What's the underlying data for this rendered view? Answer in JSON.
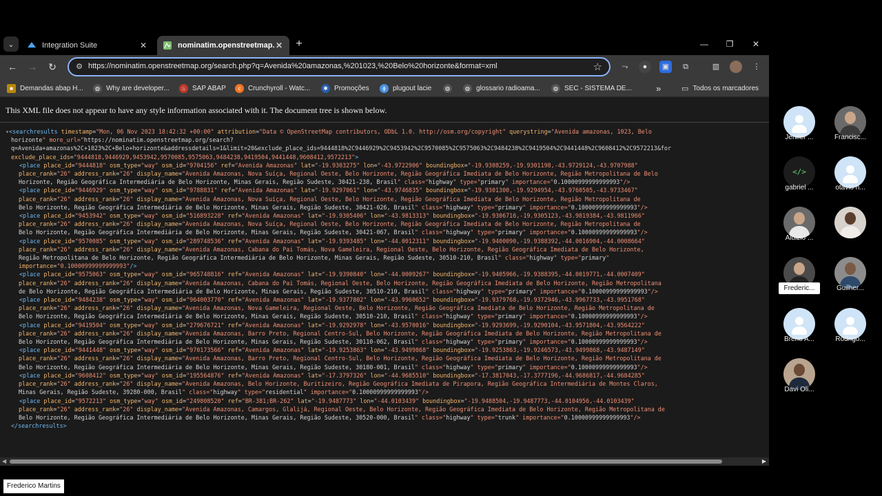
{
  "tabs": [
    {
      "label": "Integration Suite",
      "icon": "sap-icon",
      "close": "✕"
    },
    {
      "label": "nominatim.openstreetmap.org",
      "icon": "osm-icon",
      "close": "✕"
    }
  ],
  "window_controls": {
    "minimize": "—",
    "maximize": "❐",
    "close": "✕"
  },
  "omnibox": {
    "url": "https://nominatim.openstreetmap.org/search.php?q=Avenida%20amazonas,%201023,%20Belo%20horizonte&format=xml"
  },
  "bookmarks": [
    {
      "label": "Demandas abap H...",
      "icon": "bookmark-icon"
    },
    {
      "label": "Why are developer...",
      "icon": "globe-icon"
    },
    {
      "label": "SAP ABAP",
      "icon": "flame-icon"
    },
    {
      "label": "Crunchyroll - Watc...",
      "icon": "crunchyroll-icon"
    },
    {
      "label": "Promoções",
      "icon": "promo-icon"
    },
    {
      "label": "plugout lacie",
      "icon": "plug-icon"
    },
    {
      "label": "",
      "icon": "globe-icon"
    },
    {
      "label": "glossario radioama...",
      "icon": "globe-icon"
    },
    {
      "label": "SEC - SISTEMA DE...",
      "icon": "globe-icon"
    }
  ],
  "bookmarks_overflow": "»",
  "all_bookmarks": "Todos os marcadores",
  "xml_notice": "This XML file does not appear to have any style information associated with it. The document tree is shown below.",
  "xml": {
    "root_open": "<searchresults timestamp=\"Mon, 06 Nov 2023 18:42:32 +00:00\" attribution=\"Data © OpenStreetMap contributors, ODbL 1.0. http://osm.org/copyright\" querystring=\"Avenida amazonas, 1023, Belo",
    "root_lines": [
      "horizonte\" more_url=\"https://nominatim.openstreetmap.org/search?",
      "q=Avenida+amazonas%2C+1023%2C+Belo+horizonte&addressdetails=1&limit=20&exclude_place_ids=9444818%2C9446929%2C9453942%2C9570085%2C9575063%2C9484238%2C9419504%2C9441448%2C9608412%2C9572213&for",
      "exclude_place_ids=\"9444818,9446929,9453942,9570085,9575063,9484238,9419504,9441448,9608412,9572213\">"
    ],
    "places": [
      [
        "<place place_id=\"9444818\" osm_type=\"way\" osm_id=\"9704156\" ref=\"Avenida Amazonas\" lat=\"-19.9303275\" lon=\"-43.9722906\" boundingbox=\"-19.9308259,-19.9301198,-43.9729124,-43.9707988\"",
        "place_rank=\"26\" address_rank=\"26\" display_name=\"Avenida Amazonas, Nova Suíça, Regional Oeste, Belo Horizonte, Região Geográfica Imediata de Belo Horizonte, Região Metropolitana de Belo",
        "Horizonte, Região Geográfica Intermediária de Belo Horizonte, Minas Gerais, Região Sudeste, 30421-238, Brasil\" class=\"highway\" type=\"primary\" importance=\"0.10000999999999993\"/>"
      ],
      [
        "<place place_id=\"9446929\" osm_type=\"way\" osm_id=\"9788831\" ref=\"Avenida Amazonas\" lat=\"-19.9297061\" lon=\"-43.9746835\" boundingbox=\"-19.9301300,-19.9294954,-43.9760505,-43.9733467\"",
        "place_rank=\"26\" address_rank=\"26\" display_name=\"Avenida Amazonas, Nova Suíça, Regional Oeste, Belo Horizonte, Região Geográfica Imediata de Belo Horizonte, Região Metropolitana de",
        "Belo Horizonte, Região Geográfica Intermediária de Belo Horizonte, Minas Gerais, Região Sudeste, 30421-026, Brasil\" class=\"highway\" type=\"primary\" importance=\"0.10000999999999993\"/>"
      ],
      [
        "<place place_id=\"9453942\" osm_type=\"way\" osm_id=\"516893228\" ref=\"Avenida Amazonas\" lat=\"-19.9305406\" lon=\"-43.9813313\" boundingbox=\"-19.9306716,-19.9305123,-43.9819384,-43.9811966\"",
        "place_rank=\"26\" address_rank=\"26\" display_name=\"Avenida Amazonas, Nova Suíça, Regional Oeste, Belo Horizonte, Região Geográfica Imediata de Belo Horizonte, Região Metropolitana de",
        "Belo Horizonte, Região Geográfica Intermediária de Belo Horizonte, Minas Gerais, Região Sudeste, 30421-067, Brasil\" class=\"highway\" type=\"primary\" importance=\"0.10000999999999993\"/>"
      ],
      [
        "<place place_id=\"9570085\" osm_type=\"way\" osm_id=\"289748536\" ref=\"Avenida Amazonas\" lat=\"-19.9393485\" lon=\"-44.0012311\" boundingbox=\"-19.9400090,-19.9388392,-44.0016904,-44.0008664\"",
        "place_rank=\"26\" address_rank=\"26\" display_name=\"Avenida Amazonas, Cabana do Pai Tomás, Nova Gameleira, Regional Oeste, Belo Horizonte, Região Geográfica Imediata de Belo Horizonte,",
        "Região Metropolitana de Belo Horizonte, Região Geográfica Intermediária de Belo Horizonte, Minas Gerais, Região Sudeste, 30510-210, Brasil\" class=\"highway\" type=\"primary\"",
        "importance=\"0.10000999999999993\"/>"
      ],
      [
        "<place place_id=\"9575063\" osm_type=\"way\" osm_id=\"965748816\" ref=\"Avenida Amazonas\" lat=\"-19.9390840\" lon=\"-44.0009267\" boundingbox=\"-19.9405966,-19.9388395,-44.0019771,-44.0007409\"",
        "place_rank=\"26\" address_rank=\"26\" display_name=\"Avenida Amazonas, Cabana do Pai Tomás, Regional Oeste, Belo Horizonte, Região Geográfica Imediata de Belo Horizonte, Região Metropolitana",
        "de Belo Horizonte, Região Geográfica Intermediária de Belo Horizonte, Minas Gerais, Região Sudeste, 30510-210, Brasil\" class=\"highway\" type=\"primary\" importance=\"0.10000999999999993\"/>"
      ],
      [
        "<place place_id=\"9484238\" osm_type=\"way\" osm_id=\"964003770\" ref=\"Avenida Amazonas\" lat=\"-19.9377802\" lon=\"-43.9960652\" boundingbox=\"-19.9379768,-19.9372946,-43.9967733,-43.9951768\"",
        "place_rank=\"26\" address_rank=\"26\" display_name=\"Avenida Amazonas, Nova Gameleira, Regional Oeste, Belo Horizonte, Região Geográfica Imediata de Belo Horizonte, Região Metropolitana de",
        "Belo Horizonte, Região Geográfica Intermediária de Belo Horizonte, Minas Gerais, Região Sudeste, 30510-210, Brasil\" class=\"highway\" type=\"primary\" importance=\"0.10000999999999993\"/>"
      ],
      [
        "<place place_id=\"9419504\" osm_type=\"way\" osm_id=\"279676721\" ref=\"Avenida Amazonas\" lat=\"-19.9292978\" lon=\"-43.9570016\" boundingbox=\"-19.9293699,-19.9290104,-43.9571804,-43.9564222\"",
        "place_rank=\"26\" address_rank=\"26\" display_name=\"Avenida Amazonas, Barro Preto, Regional Centro-Sul, Belo Horizonte, Região Geográfica Imediata de Belo Horizonte, Região Metropolitana de",
        "Belo Horizonte, Região Geográfica Intermediária de Belo Horizonte, Minas Gerais, Região Sudeste, 30110-062, Brasil\" class=\"highway\" type=\"primary\" importance=\"0.10000999999999993\"/>"
      ],
      [
        "<place place_id=\"9441448\" osm_type=\"way\" osm_id=\"970173566\" ref=\"Avenida Amazonas\" lat=\"-19.9253863\" lon=\"-43.9499868\" boundingbox=\"-19.9253863,-19.9246573,-43.9499868,-43.9487149\"",
        "place_rank=\"26\" address_rank=\"26\" display_name=\"Avenida Amazonas, Barro Preto, Regional Centro-Sul, Belo Horizonte, Região Geográfica Imediata de Belo Horizonte, Região Metropolitana de",
        "Belo Horizonte, Região Geográfica Intermediária de Belo Horizonte, Minas Gerais, Região Sudeste, 30180-001, Brasil\" class=\"highway\" type=\"primary\" importance=\"0.10000999999999993\"/>"
      ],
      [
        "<place place_id=\"9608412\" osm_type=\"way\" osm_id=\"195564876\" ref=\"Avenida Amazonas\" lat=\"-17.3797326\" lon=\"-44.9685510\" boundingbox=\"-17.3817043,-17.3777196,-44.9686817,-44.9684285\"",
        "place_rank=\"26\" address_rank=\"26\" display_name=\"Avenida Amazonas, Belo Horizonte, Buritizeiro, Região Geográfica Imediata de Pirapora, Região Geográfica Intermediária de Montes Claros,",
        "Minas Gerais, Região Sudeste, 39280-000, Brasil\" class=\"highway\" type=\"residential\" importance=\"0.10000999999999993\"/>"
      ],
      [
        "<place place_id=\"9572213\" osm_type=\"way\" osm_id=\"249808520\" ref=\"BR-381;BR-262\" lat=\"-19.9487773\" lon=\"-44.0103439\" boundingbox=\"-19.9488504,-19.9487773,-44.0104956,-44.0103439\"",
        "place_rank=\"26\" address_rank=\"26\" display_name=\"Avenida Amazonas, Camargos, Glalijá, Regional Oeste, Belo Horizonte, Região Geográfica Imediata de Belo Horizonte, Região Metropolitana de",
        "Belo Horizonte, Região Geográfica Intermediária de Belo Horizonte, Minas Gerais, Região Sudeste, 30520-000, Brasil\" class=\"highway\" type=\"trunk\" importance=\"0.10000999999999993\"/>"
      ]
    ],
    "root_close": "</searchresults>"
  },
  "participants": [
    {
      "name": "Jenifer ...",
      "avatar": "default"
    },
    {
      "name": "Francisc...",
      "avatar": "photo"
    },
    {
      "name": "gabriel ...",
      "avatar": "code"
    },
    {
      "name": "otavio h...",
      "avatar": "default"
    },
    {
      "name": "Aluizio ...",
      "avatar": "photo"
    },
    {
      "name": "",
      "avatar": "photo"
    },
    {
      "name": "Frederic...",
      "avatar": "photo",
      "active": true
    },
    {
      "name": "Guilher...",
      "avatar": "photo"
    },
    {
      "name": "Breno A...",
      "avatar": "default"
    },
    {
      "name": "Rodrigo...",
      "avatar": "default"
    },
    {
      "name": "Davi Oli...",
      "avatar": "photo"
    }
  ],
  "self_label": "Frederico Martins",
  "colors": {
    "omnibox_focus": "#8ab4f8",
    "xml_tag": "#6fb8f0",
    "xml_attr": "#f3b56b",
    "xml_value": "#ee8f74"
  }
}
